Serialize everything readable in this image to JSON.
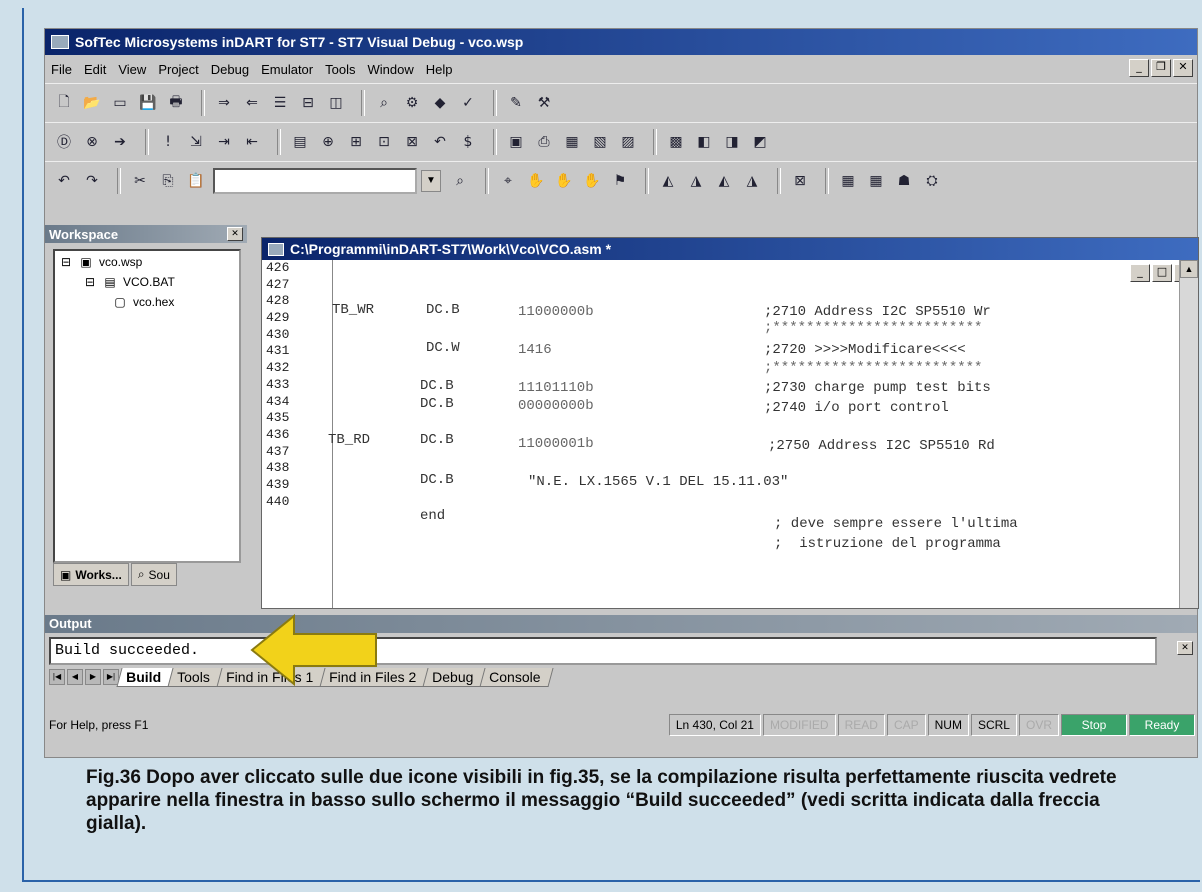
{
  "window": {
    "title": "SofTec Microsystems inDART for ST7 - ST7 Visual Debug - vco.wsp"
  },
  "menubar": {
    "items": [
      "File",
      "Edit",
      "View",
      "Project",
      "Debug",
      "Emulator",
      "Tools",
      "Window",
      "Help"
    ]
  },
  "workspace": {
    "title": "Workspace",
    "tree": [
      {
        "label": "vco.wsp"
      },
      {
        "label": "VCO.BAT"
      },
      {
        "label": "vco.hex"
      }
    ],
    "tabs": [
      {
        "label": "Works..."
      },
      {
        "label": "Sou"
      }
    ]
  },
  "editor": {
    "title": "C:\\Programmi\\inDART-ST7\\Work\\Vco\\VCO.asm *",
    "line_numbers": [
      "426",
      "427",
      "428",
      "429",
      "430",
      "431",
      "432",
      "433",
      "434",
      "435",
      "436",
      "437",
      "438",
      "439",
      "440"
    ],
    "lines": [
      {
        "label": "TB_WR",
        "op": "DC.B",
        "val": "11000000b",
        "comment": ";2710 Address I2C SP5510 Wr"
      },
      {
        "comment": ";*************************"
      },
      {
        "op": "DC.W",
        "val": "1416",
        "comment": ";2720 >>>>Modificare<<<<"
      },
      {
        "comment": ";*************************"
      },
      {
        "op": "DC.B",
        "val": "11101110b",
        "comment": ";2730 charge pump test bits"
      },
      {
        "op": "DC.B",
        "val": "00000000b",
        "comment": ";2740 i/o port control"
      },
      {
        "label": "TB_RD",
        "op": "DC.B",
        "val": "11000001b",
        "comment": ";2750 Address I2C SP5510 Rd"
      },
      {
        "op": "DC.B",
        "val": "\"N.E. LX.1565 V.1 DEL 15.11.03\""
      },
      {
        "op": "end",
        "comment": "; deve sempre essere l'ultima"
      },
      {
        "comment": ";  istruzione del programma"
      }
    ]
  },
  "output": {
    "title": "Output",
    "text": "Build succeeded.",
    "tabs": [
      {
        "label": "Build",
        "active": true
      },
      {
        "label": "Tools"
      },
      {
        "label": "Find in Files 1"
      },
      {
        "label": "Find in Files 2"
      },
      {
        "label": "Debug"
      },
      {
        "label": "Console"
      }
    ]
  },
  "statusbar": {
    "help": "For Help, press F1",
    "position": "Ln 430, Col 21",
    "modified": "MODIFIED",
    "read": "READ",
    "cap": "CAP",
    "num": "NUM",
    "scrl": "SCRL",
    "ovr": "OVR",
    "stop": "Stop",
    "ready": "Ready"
  },
  "caption": {
    "text": "Fig.36 Dopo aver cliccato sulle due icone visibili in fig.35, se la compilazione risulta perfettamente riuscita vedrete apparire nella finestra in basso sullo schermo il messaggio “Build succeeded” (vedi scritta indicata dalla freccia gialla)."
  },
  "colors": {
    "titlebar": "#0a246a",
    "arrow": "#f2d21a",
    "status_green": "#3aa36a"
  }
}
